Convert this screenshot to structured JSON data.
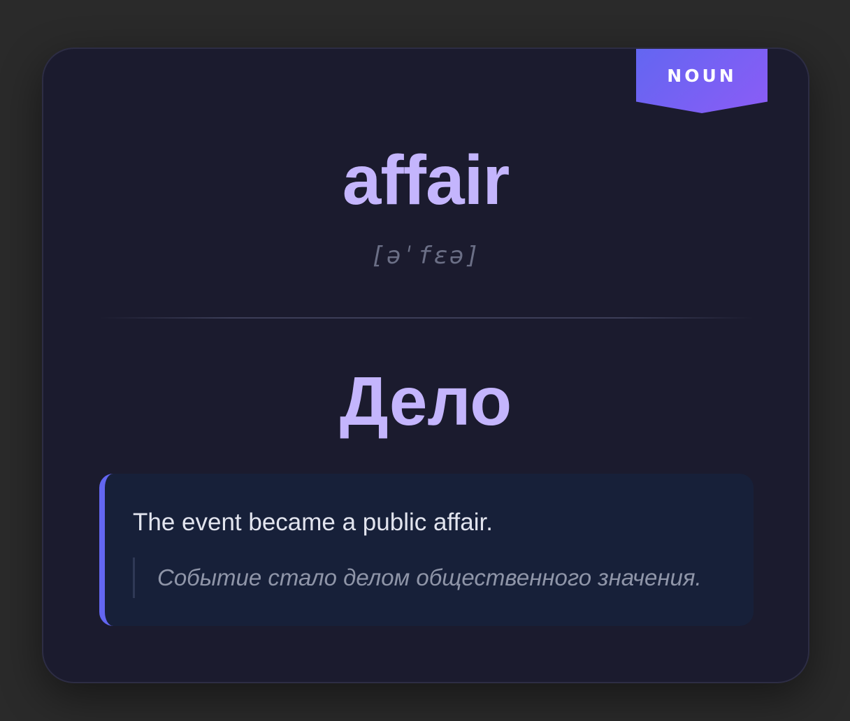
{
  "card": {
    "part_of_speech": "NOUN",
    "word": "affair",
    "phonetic": "[əˈfɛə]",
    "translation": "Дело",
    "example": {
      "sentence": "The event became a public affair.",
      "translation": "Событие стало делом общественного значения."
    }
  },
  "colors": {
    "background": "#2a2a2a",
    "card": "#1b1b2e",
    "accent": "#c4b5fd",
    "badge_gradient_start": "#6366f1",
    "badge_gradient_end": "#8b5cf6",
    "example_bg": "#172039"
  }
}
